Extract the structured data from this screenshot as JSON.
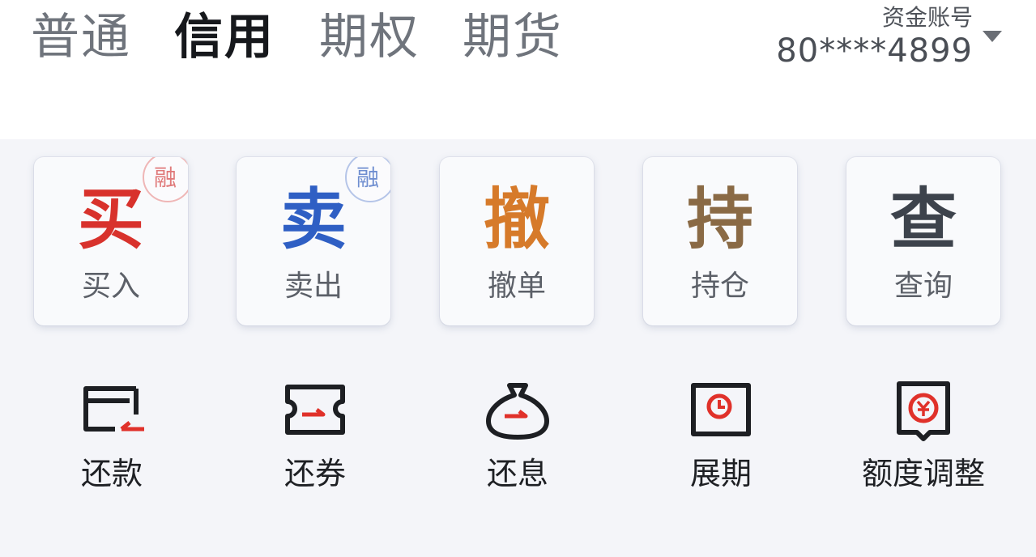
{
  "header": {
    "tabs": [
      {
        "label": "普通",
        "active": false
      },
      {
        "label": "信用",
        "active": true
      },
      {
        "label": "期权",
        "active": false
      },
      {
        "label": "期货",
        "active": false
      }
    ],
    "account": {
      "label": "资金账号",
      "number": "80****4899",
      "dropdown_icon": "caret-down-icon"
    }
  },
  "actions": [
    {
      "glyph": "买",
      "label": "买入",
      "color": "#d8322c",
      "badge": "融",
      "badge_color": "#e07a7a"
    },
    {
      "glyph": "卖",
      "label": "卖出",
      "color": "#2f5fc4",
      "badge": "融",
      "badge_color": "#6f8ed0"
    },
    {
      "glyph": "撤",
      "label": "撤单",
      "color": "#d67a2a"
    },
    {
      "glyph": "持",
      "label": "持仓",
      "color": "#8a6a45"
    },
    {
      "glyph": "查",
      "label": "查询",
      "color": "#3d434c"
    }
  ],
  "utilities": [
    {
      "label": "还款",
      "icon": "repay-card-icon"
    },
    {
      "label": "还券",
      "icon": "repay-ticket-icon"
    },
    {
      "label": "还息",
      "icon": "repay-interest-bag-icon"
    },
    {
      "label": "展期",
      "icon": "extend-clock-icon"
    },
    {
      "label": "额度调整",
      "icon": "quota-adjust-yen-icon"
    }
  ],
  "colors": {
    "accent_red": "#e0312a",
    "icon_dark": "#1d1f23",
    "panel_bg": "#f4f5f9"
  }
}
